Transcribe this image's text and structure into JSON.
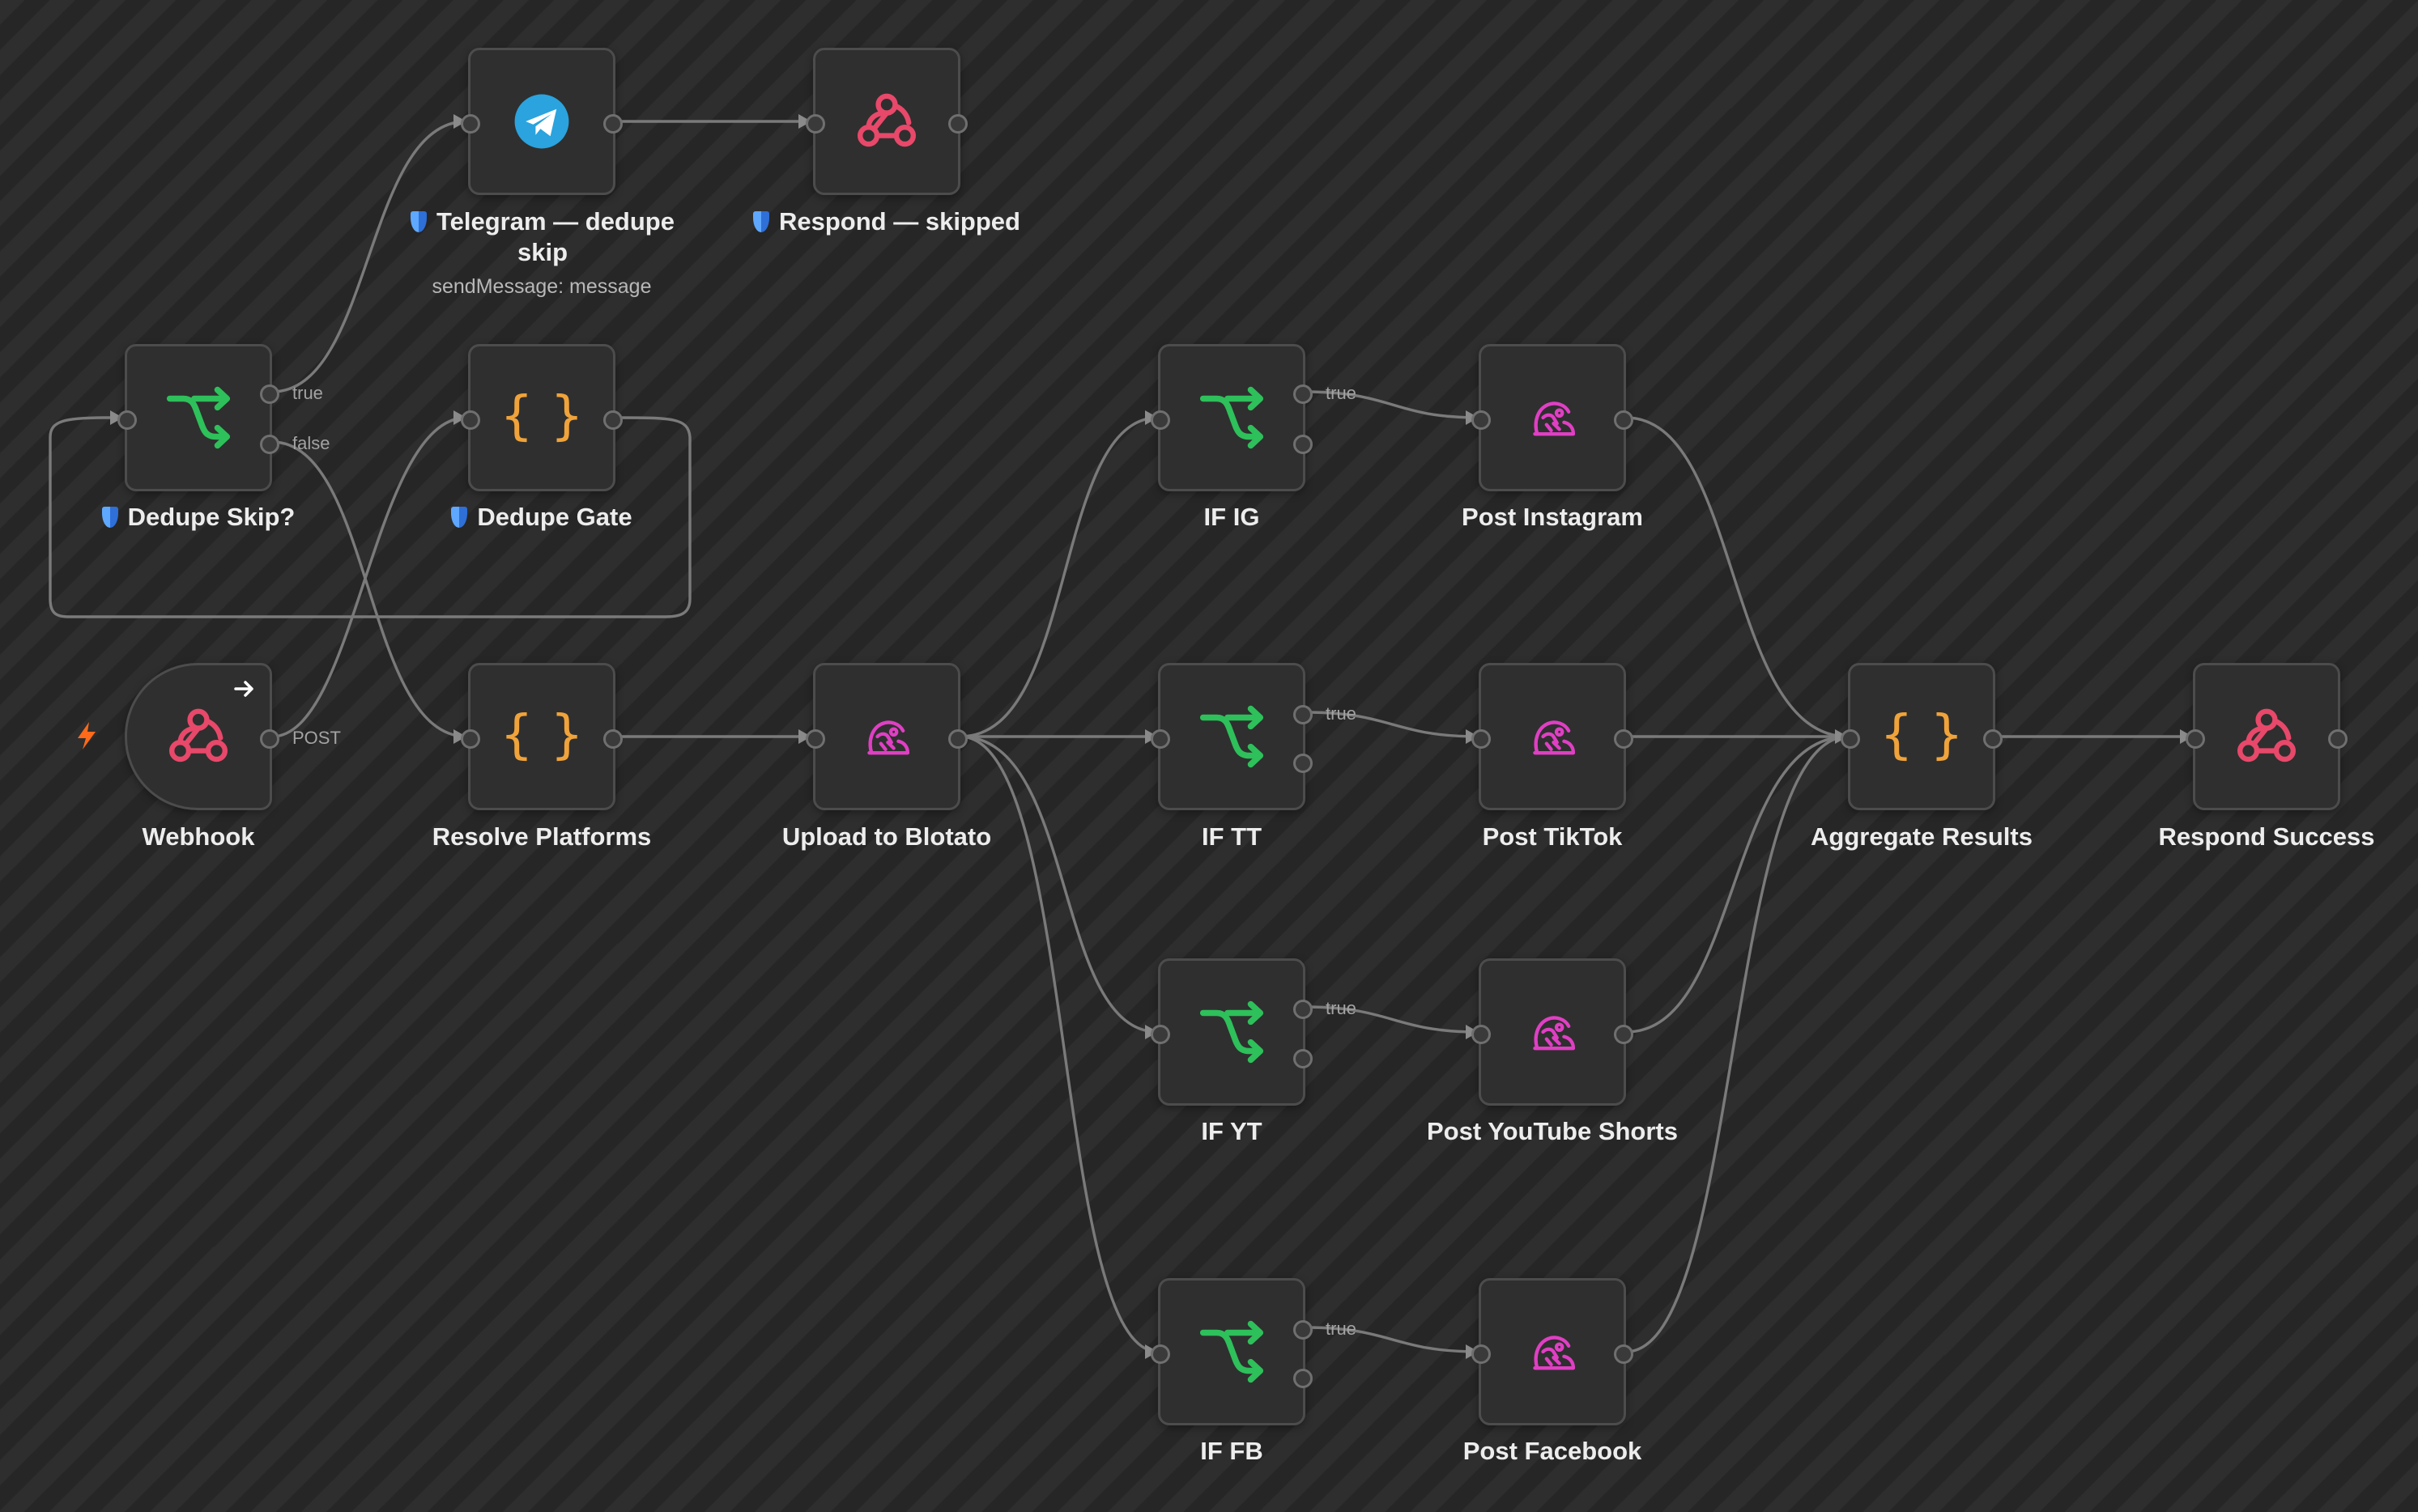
{
  "colors": {
    "background": "#2b2b2b",
    "node_fill": "#2f2f2f",
    "node_border": "#4c4c4c",
    "edge": "#7a7a7a",
    "if_icon": "#2ec05a",
    "code_icon": "#f0a33a",
    "webhook_icon": "#e8486a",
    "blotato_icon": "#e03fc4",
    "telegram_icon": "#2aa3de",
    "trigger_bolt": "#ff6a1a",
    "shield": "#4d94f2"
  },
  "nodes": {
    "webhook": {
      "label": "Webhook",
      "icon": "webhook-icon",
      "output_label": "POST"
    },
    "dedupe_skip": {
      "label": "Dedupe Skip?",
      "icon": "if-branch-icon",
      "true_label": "true",
      "false_label": "false"
    },
    "dedupe_gate": {
      "label": "Dedupe Gate",
      "icon": "code-braces-icon"
    },
    "telegram": {
      "label": "Telegram — dedupe skip",
      "subtitle": "sendMessage: message",
      "icon": "telegram-icon"
    },
    "respond_skipped": {
      "label": "Respond — skipped",
      "icon": "webhook-icon"
    },
    "resolve_platforms": {
      "label": "Resolve Platforms",
      "icon": "code-braces-icon"
    },
    "upload_blotato": {
      "label": "Upload to Blotato",
      "icon": "blotato-icon"
    },
    "if_ig": {
      "label": "IF IG",
      "icon": "if-branch-icon",
      "true_label": "true"
    },
    "if_tt": {
      "label": "IF TT",
      "icon": "if-branch-icon",
      "true_label": "true"
    },
    "if_yt": {
      "label": "IF YT",
      "icon": "if-branch-icon",
      "true_label": "true"
    },
    "if_fb": {
      "label": "IF FB",
      "icon": "if-branch-icon",
      "true_label": "true"
    },
    "post_instagram": {
      "label": "Post Instagram",
      "icon": "blotato-icon"
    },
    "post_tiktok": {
      "label": "Post TikTok",
      "icon": "blotato-icon"
    },
    "post_youtube": {
      "label": "Post YouTube Shorts",
      "icon": "blotato-icon"
    },
    "post_facebook": {
      "label": "Post Facebook",
      "icon": "blotato-icon"
    },
    "aggregate": {
      "label": "Aggregate Results",
      "icon": "code-braces-icon"
    },
    "respond_success": {
      "label": "Respond Success",
      "icon": "webhook-icon"
    }
  }
}
